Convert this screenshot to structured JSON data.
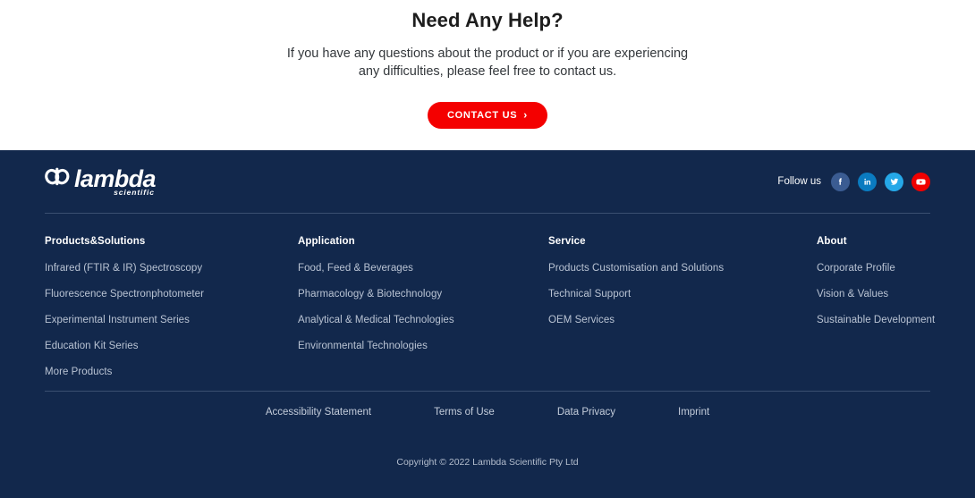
{
  "help": {
    "title": "Need Any Help?",
    "description": "If you have any questions about the product or if you are experiencing any difficulties, please feel free to contact us.",
    "cta_label": "CONTACT US",
    "cta_chevron": "›",
    "cta_color": "#f40000"
  },
  "footer": {
    "background": "#12284c",
    "logo": {
      "mark": "lambda-infinity-mark",
      "word": "lambda",
      "sub": "scientific"
    },
    "follow": {
      "label": "Follow us",
      "socials": [
        {
          "name": "facebook-icon",
          "label": "Facebook",
          "color": "#3b5c92"
        },
        {
          "name": "linkedin-icon",
          "label": "LinkedIn",
          "color": "#0a7bc0"
        },
        {
          "name": "twitter-icon",
          "label": "Twitter",
          "color": "#25a8e8"
        },
        {
          "name": "youtube-icon",
          "label": "YouTube",
          "color": "#f00000"
        }
      ]
    },
    "columns": [
      {
        "title": "Products&Solutions",
        "links": [
          "Infrared (FTIR & IR) Spectroscopy",
          "Fluorescence Spectronphotometer",
          "Experimental Instrument Series",
          "Education Kit Series",
          "More Products"
        ]
      },
      {
        "title": "Application",
        "links": [
          "Food, Feed & Beverages",
          "Pharmacology & Biotechnology",
          "Analytical & Medical Technologies",
          "Environmental Technologies"
        ]
      },
      {
        "title": "Service",
        "links": [
          "Products Customisation and Solutions",
          "Technical Support",
          "OEM Services"
        ]
      },
      {
        "title": "About",
        "links": [
          "Corporate Profile",
          "Vision & Values",
          "Sustainable Development"
        ]
      }
    ],
    "legal_links": [
      "Accessibility Statement",
      "Terms of Use",
      "Data Privacy",
      "Imprint"
    ],
    "copyright": "Copyright © 2022 Lambda Scientific Pty Ltd"
  }
}
